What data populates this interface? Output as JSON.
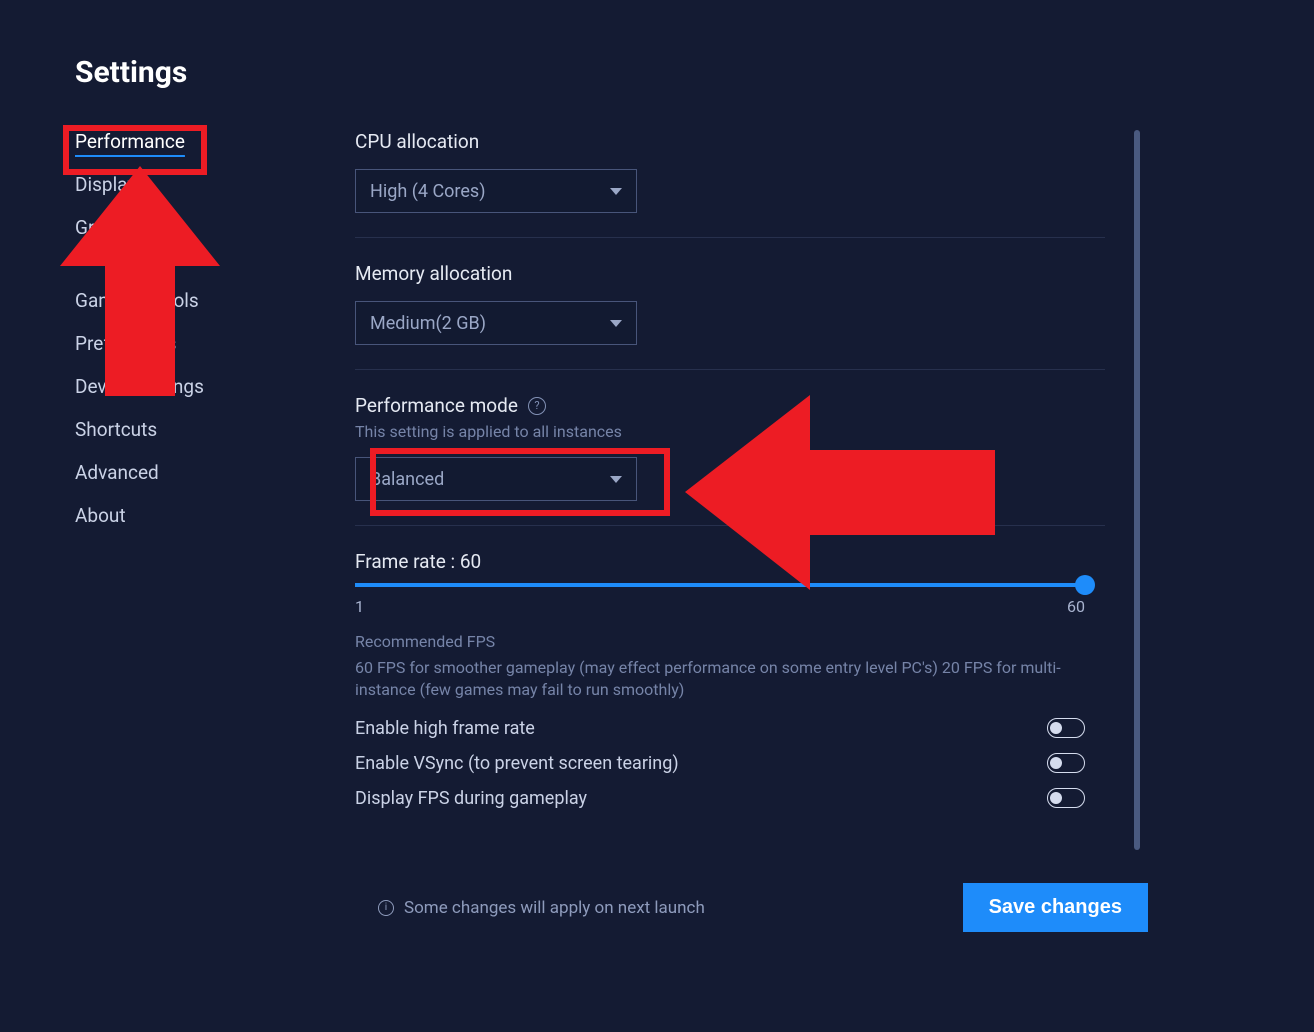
{
  "page_title": "Settings",
  "sidebar": {
    "items": [
      {
        "label": "Performance",
        "active": true
      },
      {
        "label": "Display",
        "active": false
      },
      {
        "label": "Graphics",
        "active": false
      },
      {
        "label": "Game controls",
        "active": false,
        "gap_before": true
      },
      {
        "label": "Preferences",
        "active": false
      },
      {
        "label": "Device settings",
        "active": false
      },
      {
        "label": "Shortcuts",
        "active": false
      },
      {
        "label": "Advanced",
        "active": false
      },
      {
        "label": "About",
        "active": false
      }
    ]
  },
  "settings": {
    "cpu": {
      "label": "CPU allocation",
      "value": "High (4 Cores)"
    },
    "memory": {
      "label": "Memory allocation",
      "value": "Medium(2 GB)"
    },
    "performance_mode": {
      "label": "Performance mode",
      "note": "This setting is applied to all instances",
      "value": "Balanced"
    },
    "frame_rate": {
      "label_prefix": "Frame rate : ",
      "value": 60,
      "min": 1,
      "max": 60,
      "recommended_title": "Recommended FPS",
      "recommended_body": "60 FPS for smoother gameplay (may effect performance on some entry level PC's) 20 FPS for multi-instance (few games may fail to run smoothly)"
    },
    "toggles": {
      "high_frame": {
        "label": "Enable high frame rate",
        "on": false
      },
      "vsync": {
        "label": "Enable VSync (to prevent screen tearing)",
        "on": false
      },
      "display_fps": {
        "label": "Display FPS during gameplay",
        "on": false
      }
    }
  },
  "footer": {
    "note": "Some changes will apply on next launch",
    "save": "Save changes"
  },
  "annotations": {
    "box1_desc": "red box around Performance sidebar item",
    "arrow1_desc": "red up arrow pointing to Performance",
    "box2_desc": "red box around Balanced select",
    "arrow2_desc": "red left arrow pointing to Balanced select"
  }
}
